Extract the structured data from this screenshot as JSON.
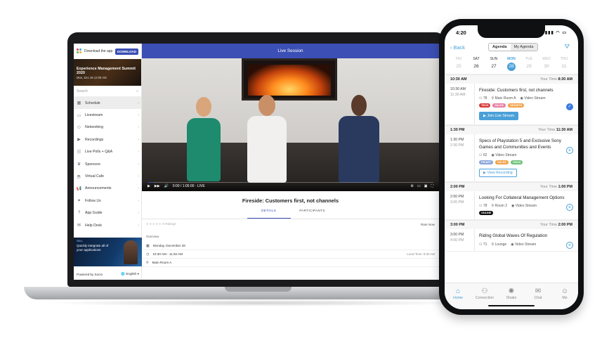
{
  "laptop": {
    "sidebar": {
      "download_text": "Download the app",
      "download_button": "DOWNLOAD",
      "event_title": "Experience Management Summit 2020",
      "event_date": "Mon, Dec 28 12:00 AM",
      "search_placeholder": "Search",
      "items": [
        {
          "label": "Schedule",
          "icon": "calendar-icon"
        },
        {
          "label": "Livestream",
          "icon": "monitor-icon"
        },
        {
          "label": "Networking",
          "icon": "people-icon"
        },
        {
          "label": "Recordings",
          "icon": "video-icon"
        },
        {
          "label": "Live Polls + Q&A",
          "icon": "poll-icon"
        },
        {
          "label": "Sponsors",
          "icon": "trophy-icon"
        },
        {
          "label": "Virtual Cafe",
          "icon": "cup-icon"
        },
        {
          "label": "Announcements",
          "icon": "megaphone-icon"
        },
        {
          "label": "Follow Us",
          "icon": "twitter-icon"
        },
        {
          "label": "App Guide",
          "icon": "help-icon"
        },
        {
          "label": "Help Desk",
          "icon": "chat-icon"
        }
      ],
      "promo_brand": "DELL",
      "promo_text": "Quickly integrate all of your applications",
      "powered_by": "Powered by Socio",
      "language": "English"
    },
    "main": {
      "header_title": "Live Session",
      "video_time": "0:00 / 1:05:00 · LIVE",
      "progress": 0.02,
      "session_title": "Fireside: Customers first, not channels",
      "tabs": [
        "DETAILS",
        "PARTICIPANTS"
      ],
      "rating_text": "0 Ratings",
      "rate_now": "Rate Now",
      "overview_label": "Overview",
      "date_line": "Monday, December 28",
      "time_line": "10:30 AM - 11:30 AM",
      "local_time": "Local Time: 8:30 AM",
      "location_line": "Main Room A"
    }
  },
  "phone": {
    "clock": "4:20",
    "back_label": "Back",
    "segments": [
      "Agenda",
      "My Agenda"
    ],
    "days": [
      {
        "label": "FRI",
        "num": "25"
      },
      {
        "label": "SAT",
        "num": "26"
      },
      {
        "label": "SUN",
        "num": "27"
      },
      {
        "label": "MON",
        "num": "28"
      },
      {
        "label": "TUE",
        "num": "29"
      },
      {
        "label": "WED",
        "num": "30"
      },
      {
        "label": "THU",
        "num": "31"
      }
    ],
    "slots": [
      {
        "time": "10:30 AM",
        "end": "11:30 AM",
        "your_time": "Your Time",
        "local": "8:30 AM",
        "title": "Fireside: Customers first, not channels",
        "count": "78",
        "room": "Main Room A",
        "stream": "Video Stream",
        "tags": [
          {
            "t": "TECH",
            "c": "#d93a3a"
          },
          {
            "t": "SALES",
            "c": "#e77fa3"
          },
          {
            "t": "GROWTH",
            "c": "#f2a24a"
          }
        ],
        "action": "Join Live Stream"
      },
      {
        "time": "1:30 PM",
        "end": "2:30 PM",
        "your_time": "Your Time",
        "local": "11:30 AM",
        "title": "Specs of Playstation 5 and Exclusive Sony Games and Communities and Events",
        "count": "62",
        "stream": "Video Stream",
        "tags": [
          {
            "t": "PR/ART",
            "c": "#8aa6d8"
          },
          {
            "t": "SALES",
            "c": "#f2a24a"
          },
          {
            "t": "CS/UX",
            "c": "#6ec27a"
          }
        ],
        "action": "View Recording"
      },
      {
        "time": "2:00 PM",
        "end": "3:00 PM",
        "your_time": "Your Time",
        "local": "1:00 PM",
        "title": "Looking For Collateral Management Options",
        "count": "78",
        "room": "Room 2",
        "stream": "Video Stream",
        "tags": [
          {
            "t": "ONLINE",
            "c": "#111111"
          }
        ]
      },
      {
        "time": "3:00 PM",
        "end": "4:00 PM",
        "your_time": "Your Time",
        "local": "2:00 PM",
        "title": "Riding Global Waves Of Regulation",
        "count": "71",
        "room": "Lounge",
        "stream": "Video Stream"
      }
    ],
    "tabbar": [
      "Home",
      "Connection",
      "Shake",
      "Chat",
      "Me"
    ]
  }
}
